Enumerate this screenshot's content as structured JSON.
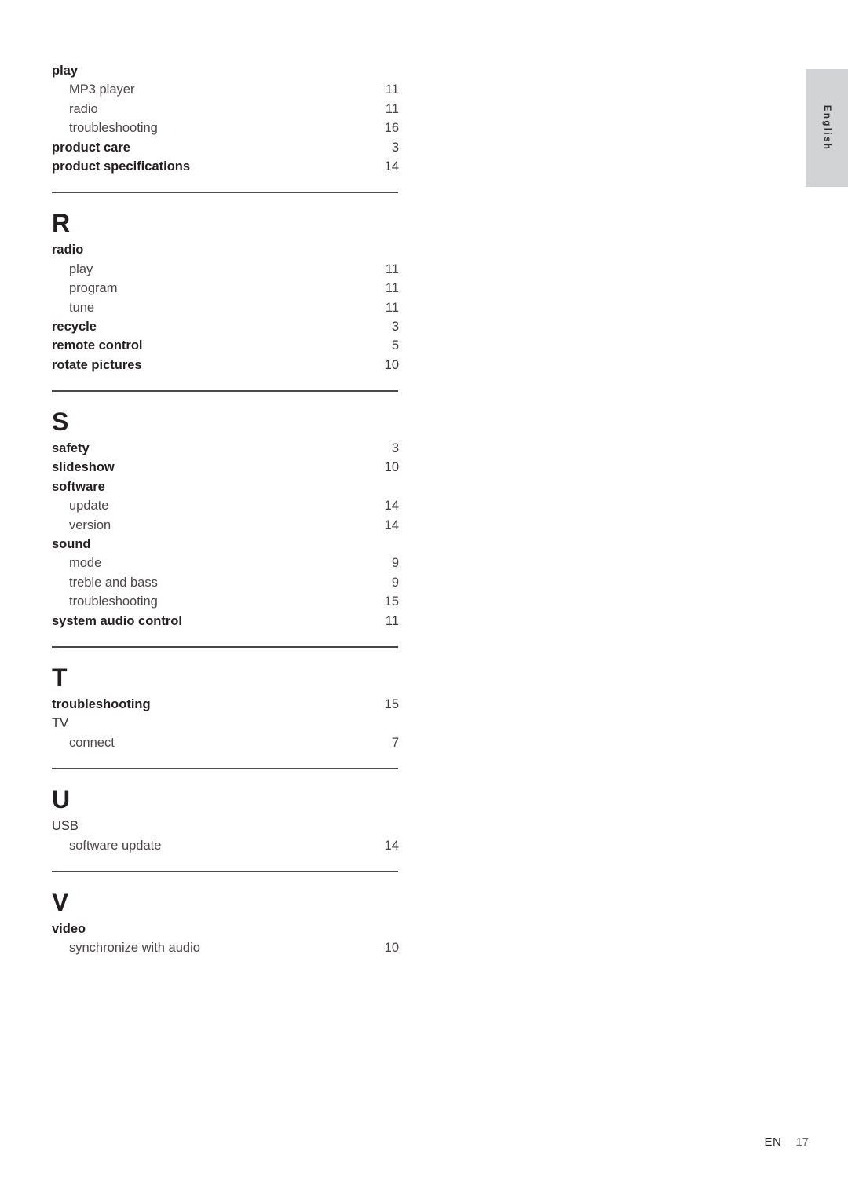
{
  "side_tab": {
    "label": "English"
  },
  "footer": {
    "language_code": "EN",
    "page_number": "17"
  },
  "index": {
    "sections": [
      {
        "letter": "",
        "has_rule_above": false,
        "entries": [
          {
            "label": "play",
            "page": "",
            "level": "main"
          },
          {
            "label": "MP3 player",
            "page": "11",
            "level": "sub"
          },
          {
            "label": "radio",
            "page": "11",
            "level": "sub"
          },
          {
            "label": "troubleshooting",
            "page": "16",
            "level": "sub"
          },
          {
            "label": "product care",
            "page": "3",
            "level": "main"
          },
          {
            "label": "product specifications",
            "page": "14",
            "level": "main"
          }
        ]
      },
      {
        "letter": "R",
        "has_rule_above": true,
        "entries": [
          {
            "label": "radio",
            "page": "",
            "level": "main"
          },
          {
            "label": "play",
            "page": "11",
            "level": "sub"
          },
          {
            "label": "program",
            "page": "11",
            "level": "sub"
          },
          {
            "label": "tune",
            "page": "11",
            "level": "sub"
          },
          {
            "label": "recycle",
            "page": "3",
            "level": "main"
          },
          {
            "label": "remote control",
            "page": "5",
            "level": "main"
          },
          {
            "label": "rotate pictures",
            "page": "10",
            "level": "main"
          }
        ]
      },
      {
        "letter": "S",
        "has_rule_above": true,
        "entries": [
          {
            "label": "safety",
            "page": "3",
            "level": "main"
          },
          {
            "label": "slideshow",
            "page": "10",
            "level": "main"
          },
          {
            "label": "software",
            "page": "",
            "level": "main"
          },
          {
            "label": "update",
            "page": "14",
            "level": "sub"
          },
          {
            "label": "version",
            "page": "14",
            "level": "sub"
          },
          {
            "label": "sound",
            "page": "",
            "level": "main"
          },
          {
            "label": "mode",
            "page": "9",
            "level": "sub"
          },
          {
            "label": "treble and bass",
            "page": "9",
            "level": "sub"
          },
          {
            "label": "troubleshooting",
            "page": "15",
            "level": "sub"
          },
          {
            "label": "system audio control",
            "page": "11",
            "level": "main"
          }
        ]
      },
      {
        "letter": "T",
        "has_rule_above": true,
        "entries": [
          {
            "label": "troubleshooting",
            "page": "15",
            "level": "main"
          },
          {
            "label": "TV",
            "page": "",
            "level": "plain"
          },
          {
            "label": "connect",
            "page": "7",
            "level": "sub"
          }
        ]
      },
      {
        "letter": "U",
        "has_rule_above": true,
        "entries": [
          {
            "label": "USB",
            "page": "",
            "level": "plain"
          },
          {
            "label": "software update",
            "page": "14",
            "level": "sub"
          }
        ]
      },
      {
        "letter": "V",
        "has_rule_above": true,
        "entries": [
          {
            "label": "video",
            "page": "",
            "level": "main"
          },
          {
            "label": "synchronize with audio",
            "page": "10",
            "level": "sub"
          }
        ]
      }
    ]
  }
}
